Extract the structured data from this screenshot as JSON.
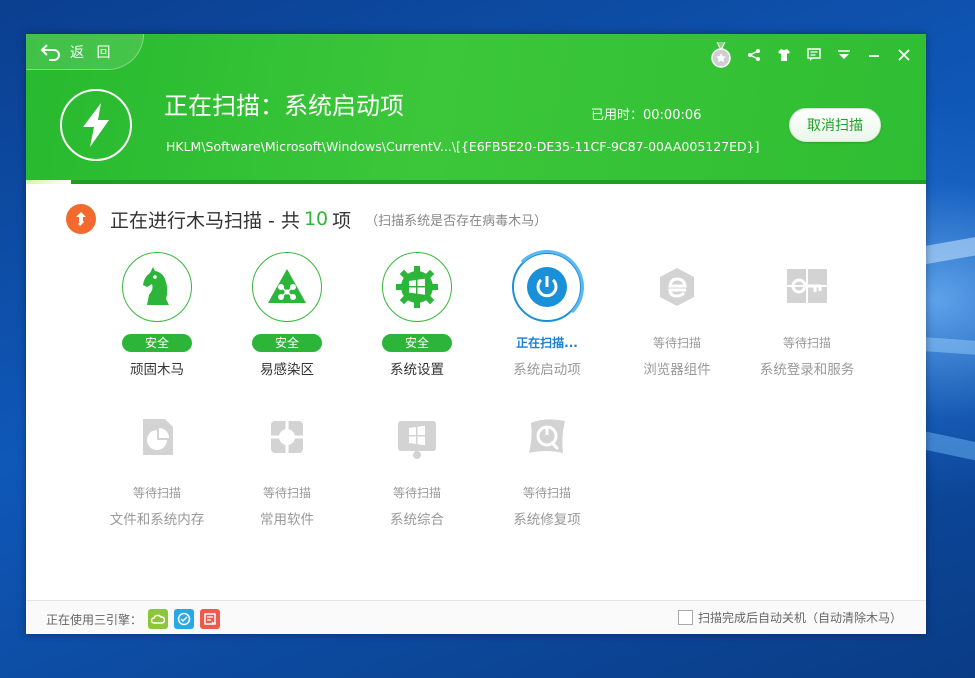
{
  "header": {
    "back_label": "返 回",
    "scan_title": "正在扫描：系统启动项",
    "elapsed": "已用时：00:00:06",
    "reg_path": "HKLM\\Software\\Microsoft\\Windows\\CurrentV...\\[{E6FB5E20-DE35-11CF-9C87-00AA005127ED}]",
    "cancel_label": "取消扫描",
    "progress": 0.05
  },
  "section": {
    "title_prefix": "正在进行木马扫描 - 共",
    "count": "10",
    "title_suffix": "项",
    "subtitle": "（扫描系统是否存在病毒木马）"
  },
  "items": [
    {
      "label": "顽固木马",
      "status": "安全",
      "state": "safe",
      "icon": "horse-icon"
    },
    {
      "label": "易感染区",
      "status": "安全",
      "state": "safe",
      "icon": "network-warning-icon"
    },
    {
      "label": "系统设置",
      "status": "安全",
      "state": "safe",
      "icon": "windows-gear-icon"
    },
    {
      "label": "系统启动项",
      "status": "正在扫描...",
      "state": "scanning",
      "icon": "power-icon"
    },
    {
      "label": "浏览器组件",
      "status": "等待扫描",
      "state": "waiting",
      "icon": "browser-e-icon"
    },
    {
      "label": "系统登录和服务",
      "status": "等待扫描",
      "state": "waiting",
      "icon": "key-icon"
    },
    {
      "label": "文件和系统内存",
      "status": "等待扫描",
      "state": "waiting",
      "icon": "file-pie-icon"
    },
    {
      "label": "常用软件",
      "status": "等待扫描",
      "state": "waiting",
      "icon": "apps-icon"
    },
    {
      "label": "系统综合",
      "status": "等待扫描",
      "state": "waiting",
      "icon": "windows-search-icon"
    },
    {
      "label": "系统修复项",
      "status": "等待扫描",
      "state": "waiting",
      "icon": "windows-repair-icon"
    }
  ],
  "footer": {
    "engines_label": "正在使用三引擎：",
    "auto_shutdown_label": "扫描完成后自动关机（自动清除木马）"
  },
  "colors": {
    "green": "#2db53a",
    "blue": "#1a90d9",
    "orange": "#f26a2e"
  }
}
